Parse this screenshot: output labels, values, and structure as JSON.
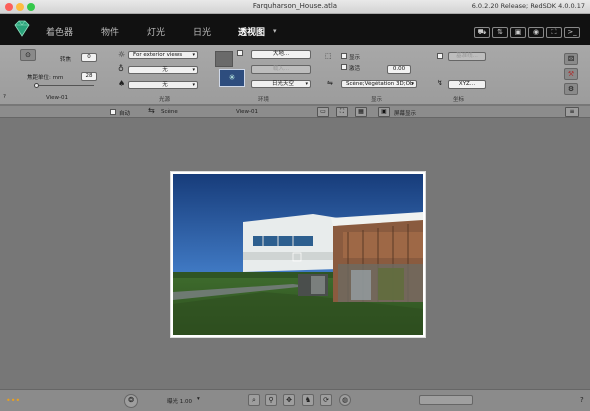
{
  "window": {
    "title": "Farquharson_House.atla",
    "release": "6.0.2.20 Release; RedSDK 4.0.0.17"
  },
  "header": {
    "tabs": [
      {
        "label": "着色器"
      },
      {
        "label": "物件"
      },
      {
        "label": "灯光"
      },
      {
        "label": "日光"
      },
      {
        "label": "透视图"
      }
    ],
    "active_tab": "透视图",
    "dropdown_caret": "▾"
  },
  "camera": {
    "focal_label": "转焦",
    "focal_value": "0",
    "unit_label": "焦距单位: mm",
    "unit_value": "28",
    "view_name": "View-01"
  },
  "lighting": {
    "mode": "For exterior views",
    "option2": "无",
    "option3": "无",
    "section_label": "光源"
  },
  "environment": {
    "btn_bg": "大地...",
    "btn_import": "载入...",
    "sky": "日光天空",
    "section_label": "环境"
  },
  "display": {
    "show_label": "显示",
    "activate_label": "激活",
    "value": "0.00",
    "scene_select": "Scène;Végétation 3D;Ob",
    "section_label": "显示"
  },
  "axis": {
    "set_label": "基准线...",
    "xyz_label": "XYZ...",
    "section_label": "坐标"
  },
  "viewbar": {
    "auto_label": "自动",
    "scene_label": "Scène",
    "view_label": "View-01",
    "fullscreen_label": "屏幕显示"
  },
  "bottombar": {
    "exposure": "曝光 1.00",
    "more": "•••",
    "help": "?"
  },
  "colors": {
    "header_bg": "#111111",
    "panel_bg": "#a3a3a3",
    "viewport_bg": "#777777",
    "sky_top": "#1a4a8a",
    "grass": "#3d5e2a"
  }
}
